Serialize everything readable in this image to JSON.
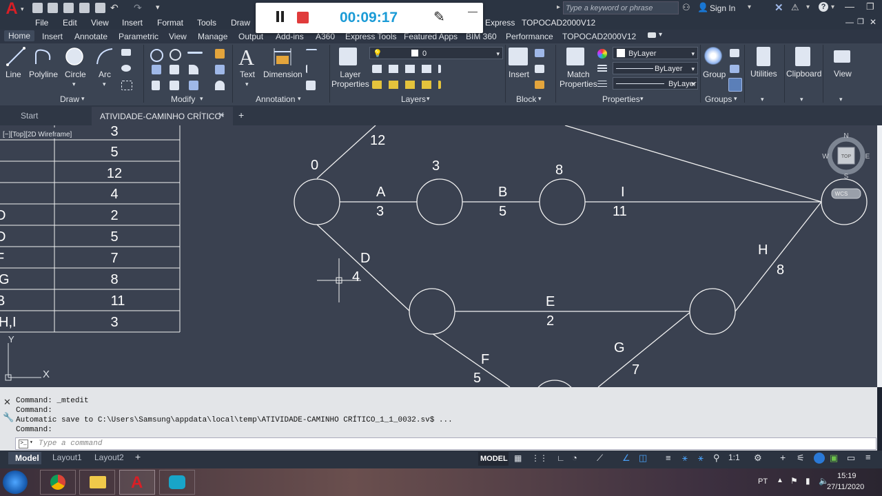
{
  "app": {
    "search_placeholder": "Type a keyword or phrase",
    "sign_in": "Sign In",
    "express_label": "Express",
    "topocad_label": "TOPOCAD2000V12"
  },
  "recorder": {
    "time": "00:09:17"
  },
  "menu": [
    "File",
    "Edit",
    "View",
    "Insert",
    "Format",
    "Tools",
    "Draw"
  ],
  "ribbon_tabs": [
    "Home",
    "Insert",
    "Annotate",
    "Parametric",
    "View",
    "Manage",
    "Output",
    "Add-ins",
    "A360",
    "Express Tools",
    "Featured Apps",
    "BIM 360",
    "Performance",
    "TOPOCAD2000V12"
  ],
  "ribbon": {
    "draw_tools": [
      "Line",
      "Polyline",
      "Circle",
      "Arc"
    ],
    "text": "Text",
    "dimension": "Dimension",
    "layer_properties": "Layer\nProperties",
    "layer_current": "0",
    "insert": "Insert",
    "match_properties": "Match\nProperties",
    "bylayer_color": "ByLayer",
    "bylayer_linetype": "ByLayer",
    "bylayer_lineweight": "ByLayer",
    "group": "Group",
    "utilities": "Utilities",
    "clipboard": "Clipboard",
    "view": "View",
    "panels": [
      "Draw",
      "Modify",
      "Annotation",
      "Layers",
      "Block",
      "Properties",
      "Groups"
    ]
  },
  "doc_tabs": {
    "start": "Start",
    "active": "ATIVIDADE-CAMINHO CRÍTICO*"
  },
  "viewport": {
    "label": "[−][Top][2D Wireframe]",
    "cube_top": "TOP",
    "compass": {
      "n": "N",
      "s": "S",
      "e": "E",
      "w": "W"
    },
    "wcs": "WCS",
    "ucs_x": "X",
    "ucs_y": "Y"
  },
  "table": {
    "left_col": [
      "",
      "",
      "",
      "",
      "D",
      "D",
      "F",
      "G",
      "B",
      "H,I"
    ],
    "right_col": [
      "3",
      "5",
      "12",
      "4",
      "2",
      "5",
      "7",
      "8",
      "11",
      "3"
    ]
  },
  "network": {
    "top_label_12": "12",
    "node_label_0": "0",
    "node_label_3": "3",
    "node_label_8": "8",
    "edges": [
      {
        "name": "A",
        "duration": "3"
      },
      {
        "name": "B",
        "duration": "5"
      },
      {
        "name": "I",
        "duration": "11"
      },
      {
        "name": "D",
        "duration": "4"
      },
      {
        "name": "E",
        "duration": "2"
      },
      {
        "name": "H",
        "duration": "8"
      },
      {
        "name": "F",
        "duration": "5"
      },
      {
        "name": "G",
        "duration": "7"
      }
    ]
  },
  "command": {
    "lines": [
      "Command: _mtedit",
      "Command:",
      "Automatic save to C:\\Users\\Samsung\\appdata\\local\\temp\\ATIVIDADE-CAMINHO CRÍTICO_1_1_0032.sv$ ...",
      "Command:"
    ],
    "placeholder": "Type a command"
  },
  "layout_tabs": [
    "Model",
    "Layout1",
    "Layout2"
  ],
  "status": {
    "model": "MODEL",
    "scale": "1:1"
  },
  "taskbar": {
    "lang": "PT",
    "time": "15:19",
    "date": "27/11/2020"
  }
}
